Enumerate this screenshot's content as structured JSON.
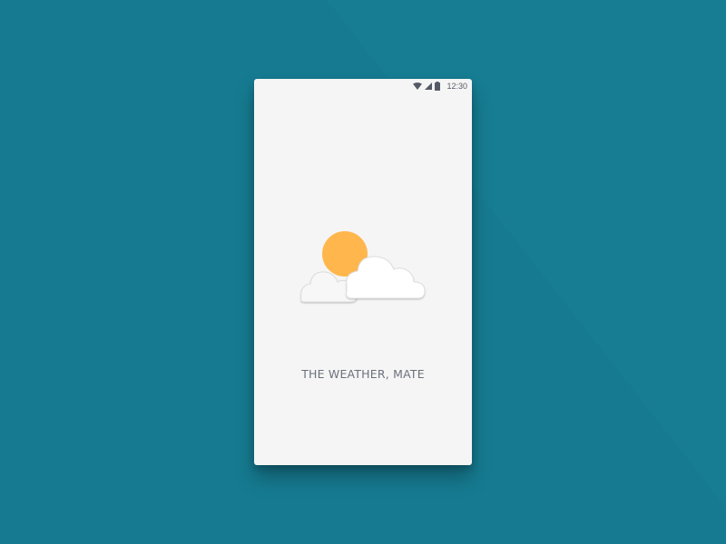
{
  "background": {
    "color": "#167b91"
  },
  "phone": {
    "screen_color": "#f5f5f5",
    "status_bar": {
      "icons": [
        "wifi-icon",
        "signal-icon",
        "battery-icon"
      ],
      "time": "12:30"
    },
    "splash": {
      "illustration": [
        "sun-icon",
        "cloud-icon"
      ],
      "sun_color": "#ffb74d",
      "cloud_color": "#ffffff",
      "title": "THE WEATHER, MATE"
    }
  }
}
